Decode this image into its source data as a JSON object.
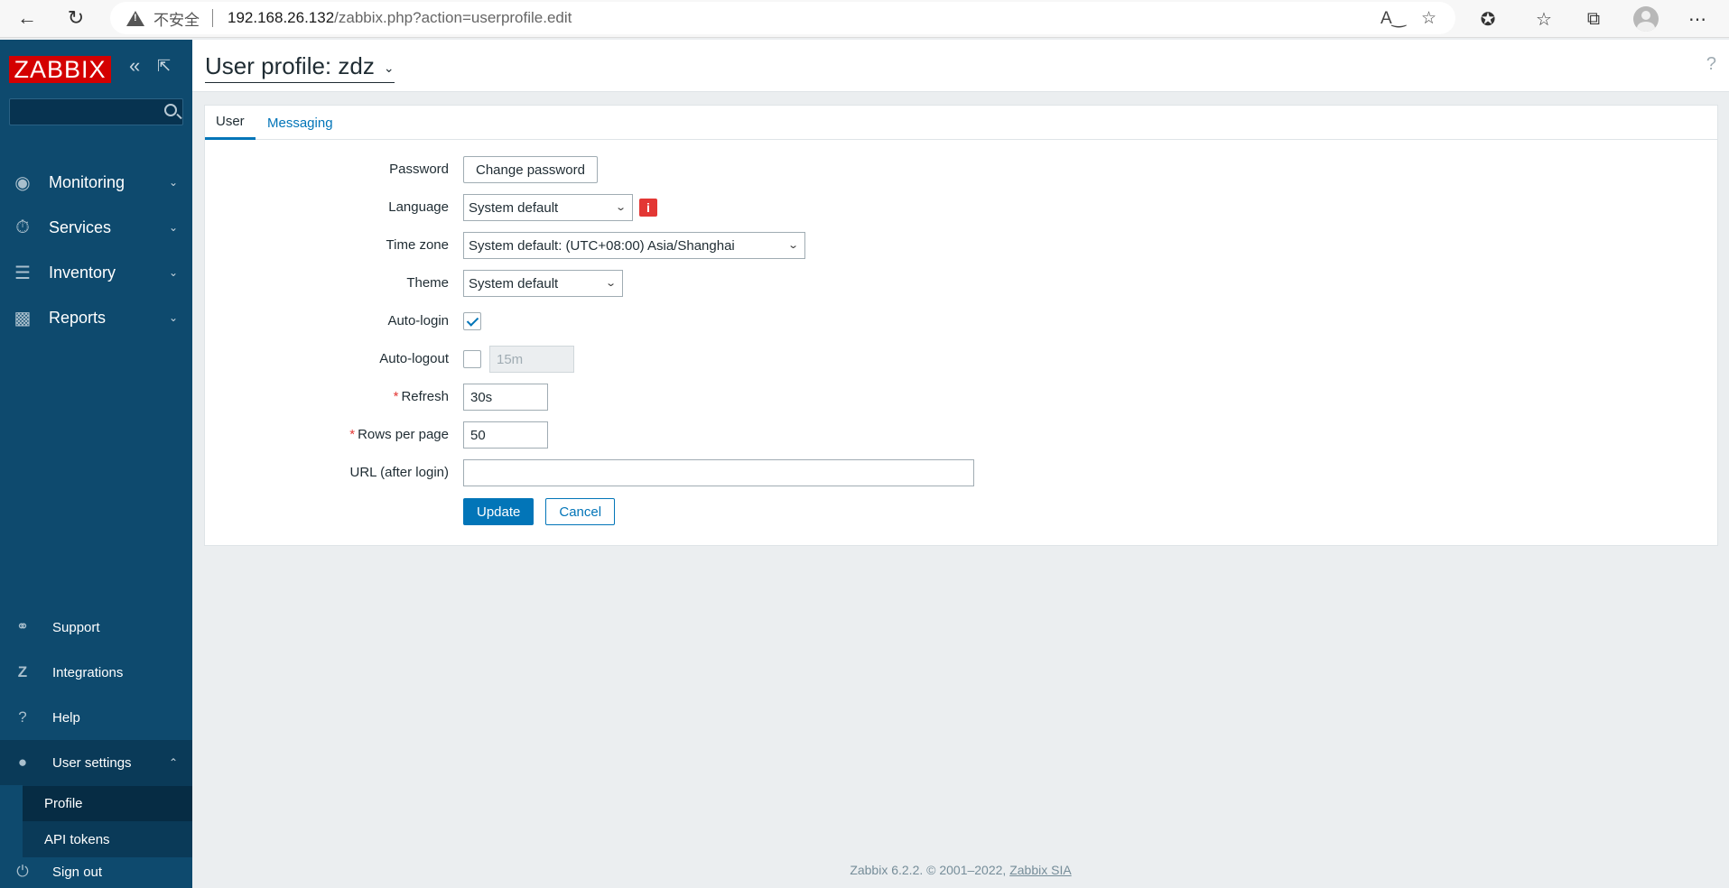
{
  "browser": {
    "security_label": "不安全",
    "url_host": "192.168.26.132",
    "url_path": "/zabbix.php?action=userprofile.edit"
  },
  "sidebar": {
    "logo": "ZABBIX",
    "search_placeholder": "",
    "menu": [
      {
        "label": "Monitoring",
        "icon": "eye-icon"
      },
      {
        "label": "Services",
        "icon": "stopwatch-icon"
      },
      {
        "label": "Inventory",
        "icon": "list-icon"
      },
      {
        "label": "Reports",
        "icon": "bar-chart-icon"
      }
    ],
    "bottom_menu": [
      {
        "label": "Support",
        "icon": "headset-icon"
      },
      {
        "label": "Integrations",
        "icon": "zabbix-z-icon"
      },
      {
        "label": "Help",
        "icon": "question-icon"
      },
      {
        "label": "User settings",
        "icon": "user-icon"
      }
    ],
    "submenu": [
      "Profile",
      "API tokens"
    ],
    "sign_out": "Sign out"
  },
  "header": {
    "title": "User profile: zdz",
    "help": "?"
  },
  "tabs": [
    "User",
    "Messaging"
  ],
  "form": {
    "password_label": "Password",
    "change_password": "Change password",
    "language_label": "Language",
    "language_value": "System default",
    "timezone_label": "Time zone",
    "timezone_value": "System default: (UTC+08:00) Asia/Shanghai",
    "theme_label": "Theme",
    "theme_value": "System default",
    "autologin_label": "Auto-login",
    "autologin_checked": true,
    "autologout_label": "Auto-logout",
    "autologout_checked": false,
    "autologout_value": "15m",
    "refresh_label": "Refresh",
    "refresh_value": "30s",
    "rows_label": "Rows per page",
    "rows_value": "50",
    "url_label": "URL (after login)",
    "url_value": "",
    "required_mark": "*",
    "update": "Update",
    "cancel": "Cancel"
  },
  "footer": {
    "text": "Zabbix 6.2.2. © 2001–2022,",
    "link": "Zabbix SIA"
  },
  "colors": {
    "sidebar": "#0e4a6e",
    "accent": "#0275b8",
    "logo": "#d40000",
    "error": "#e33734"
  }
}
